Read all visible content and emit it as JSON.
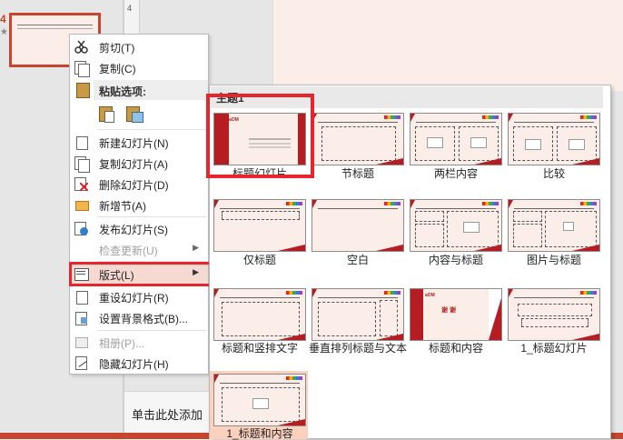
{
  "slide_panel": {
    "slide_number": "4",
    "star": "★"
  },
  "ruler": {
    "mark": "4"
  },
  "notes": {
    "placeholder": "单击此处添加"
  },
  "context_menu": {
    "cut": "剪切(T)",
    "copy": "复制(C)",
    "paste_header": "粘贴选项:",
    "new_slide": "新建幻灯片(N)",
    "duplicate_slide": "复制幻灯片(A)",
    "delete_slide": "删除幻灯片(D)",
    "add_section": "新增节(A)",
    "publish_slides": "发布幻灯片(S)",
    "check_updates": "检查更新(U)",
    "layout": "版式(L)",
    "reset_slide": "重设幻灯片(R)",
    "format_background": "设置背景格式(B)...",
    "photo_album": "相册(P)...",
    "hide_slide": "隐藏幻灯片(H)",
    "submenu_arrow": "▶"
  },
  "gallery": {
    "header": "主题1",
    "layouts": [
      "标题幻灯片",
      "节标题",
      "两栏内容",
      "比较",
      "仅标题",
      "空白",
      "内容与标题",
      "图片与标题",
      "标题和竖排文字",
      "垂直排列标题与文本",
      "标题和内容",
      "1_标题幻灯片",
      "1_标题和内容"
    ],
    "thankyou_text": "谢 谢",
    "logo_text": "aOM"
  },
  "colors": {
    "accent_red": "#e8242c",
    "theme_red": "#b51d22",
    "slide_bg": "#fbeee8",
    "selected_tile": "#fbd0bd"
  }
}
